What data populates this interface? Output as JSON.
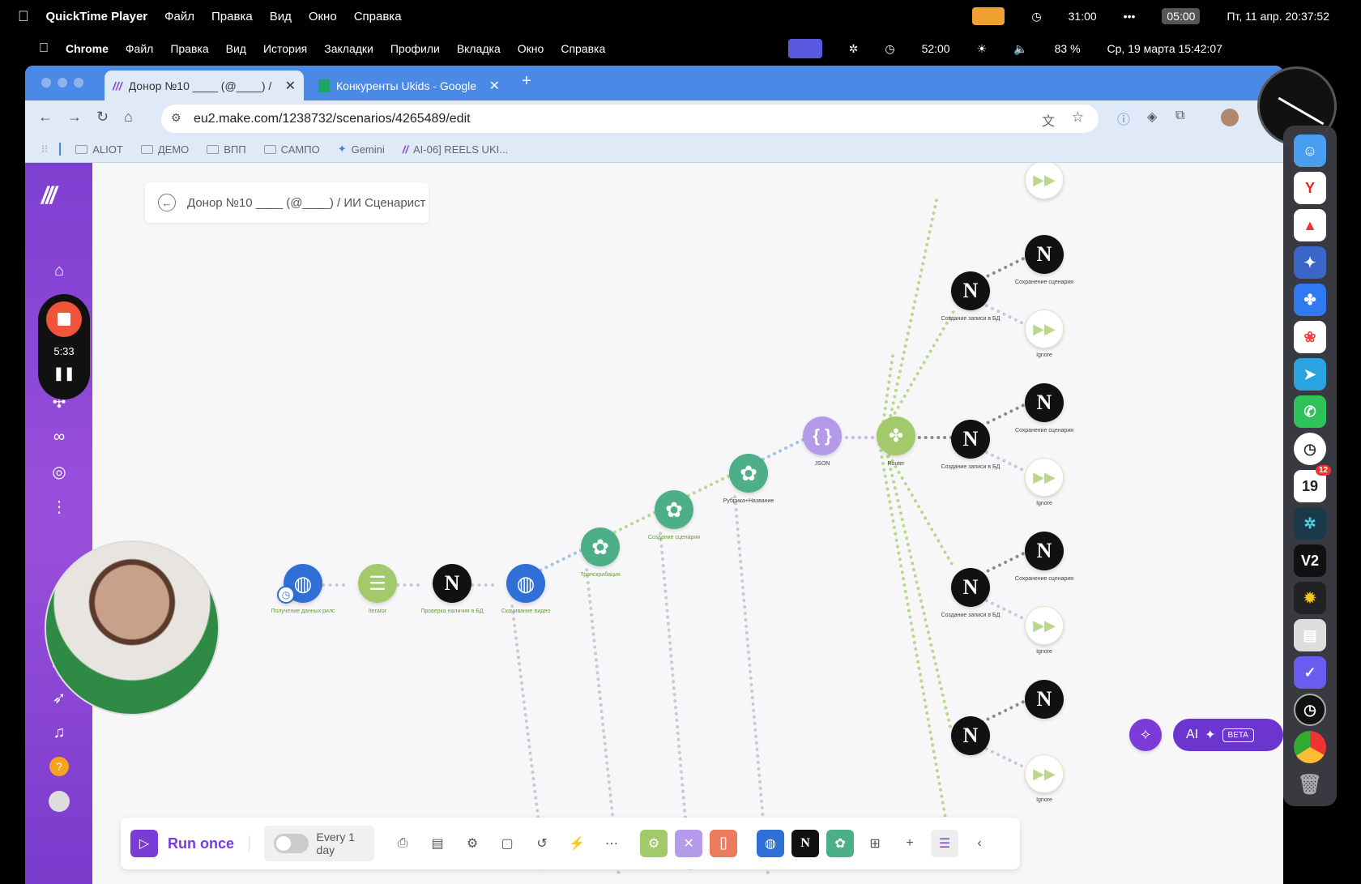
{
  "qt_menubar": {
    "app": "QuickTime Player",
    "items": [
      "Файл",
      "Правка",
      "Вид",
      "Окно",
      "Справка"
    ],
    "timer": "31:00",
    "badge": "05:00",
    "datetime": "Пт, 11 апр. 20:37:52"
  },
  "mac_menubar": {
    "app": "Chrome",
    "items": [
      "Файл",
      "Правка",
      "Вид",
      "История",
      "Закладки",
      "Профили",
      "Вкладка",
      "Окно",
      "Справка"
    ],
    "timer": "52:00",
    "battery": "83 %",
    "datetime": "Ср, 19 марта 15:42:07"
  },
  "tabs": [
    {
      "label": "Донор №10 ____ (@____) / И"
    },
    {
      "label": "Конкуренты Ukids - Google"
    }
  ],
  "url": "eu2.make.com/1238732/scenarios/4265489/edit",
  "bookmarks": [
    "ALIOT",
    "ДЕМО",
    "ВПП",
    "САМПО",
    "Gemini",
    "AI-06] REELS UKI..."
  ],
  "breadcrumb": "Донор №10 ____ (@____) / ИИ Сценарист",
  "recording": {
    "time": "5:33"
  },
  "nodes": {
    "n1": "Получение данных рилс",
    "n2": "Iterator",
    "n3": "Проверка наличия в БД",
    "n4": "Скачивание видео",
    "n5": "Транскрибация",
    "n6": "Создание сценария",
    "n7": "Рубрика+Название",
    "n8": "JSON",
    "n9": "Router",
    "notion_create": "Создание записи в БД",
    "notion_save": "Сохранение сценария",
    "ignore": "Ignore"
  },
  "toolbar": {
    "run_label": "Run once",
    "schedule": "Every 1 day",
    "ai_label": "AI",
    "beta": "BETA"
  },
  "dock": {
    "cal_day": "19",
    "cal_badge": "12",
    "v2": "V2"
  },
  "colors": {
    "make_purple": "#8a45d6",
    "openai_green": "#4caf87",
    "router_green": "#a2c96a",
    "notion_black": "#111111",
    "http_blue": "#2f6fd6"
  }
}
